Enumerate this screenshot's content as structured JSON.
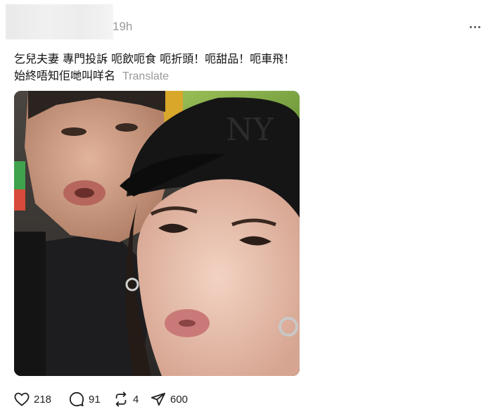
{
  "post": {
    "timestamp": "19h",
    "caption_line1": "乞兒夫妻 專門投訴 呃飲呃食 呃折頭！呃甜品！呃車飛！",
    "caption_line2": "始終唔知佢哋叫咩名",
    "translate_label": "Translate",
    "image_icon": "photo-selfie"
  },
  "actions": {
    "likes": "218",
    "replies": "91",
    "reposts": "4",
    "shares": "600"
  },
  "icons": {
    "like": "heart-icon",
    "reply": "speech-bubble-icon",
    "repost": "repost-arrows-icon",
    "share": "paper-plane-icon",
    "more": "more-dots-icon"
  }
}
